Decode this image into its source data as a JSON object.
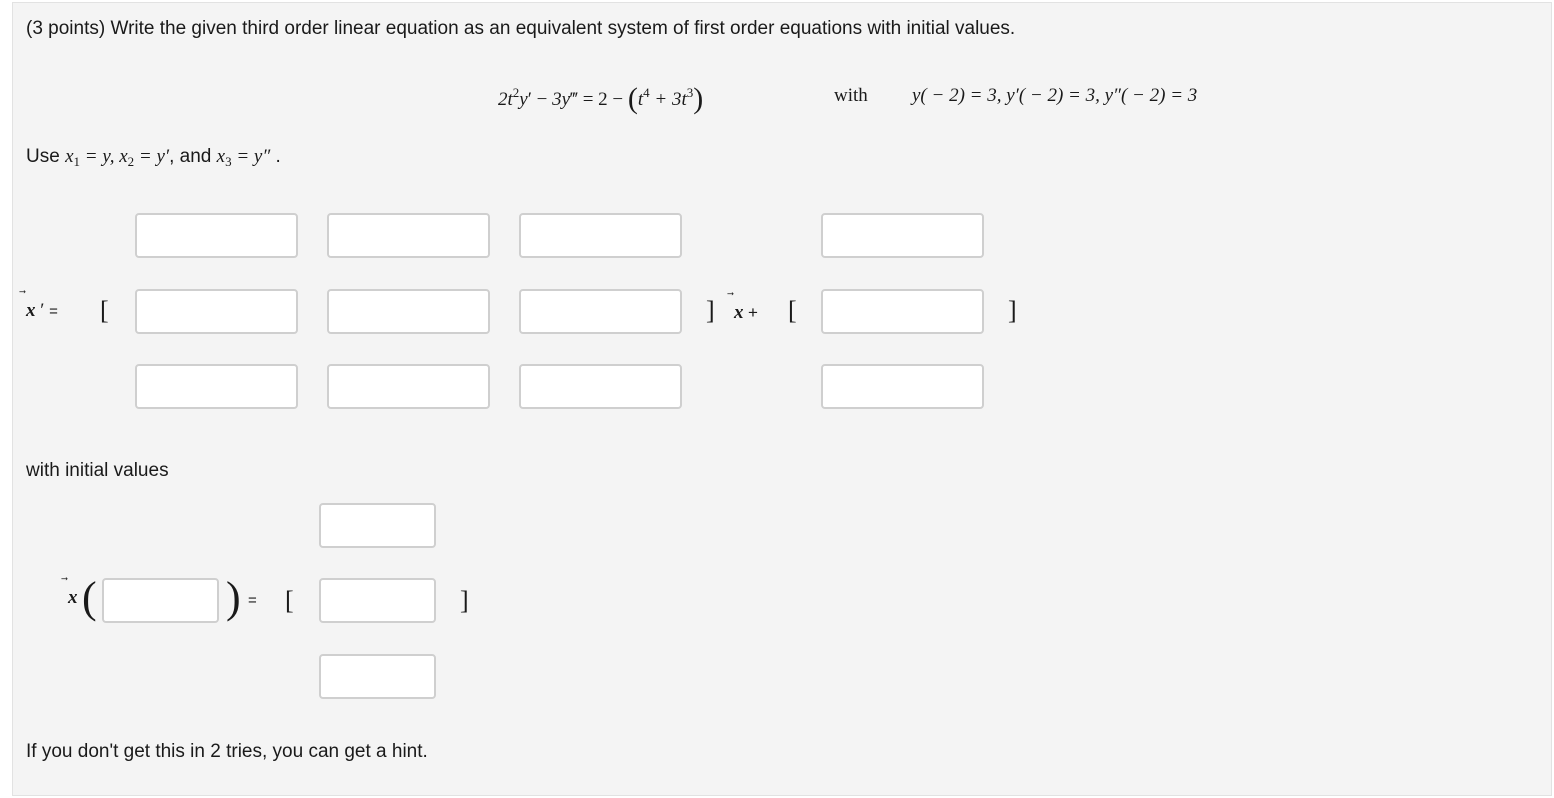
{
  "prompt": "(3 points) Write the given third order linear equation as an equivalent system of first order equations with initial values.",
  "equation": {
    "lhs_a": "2t",
    "lhs_a_exp": "2",
    "lhs_b": "y",
    "lhs_b_prime": "′",
    "minus": "−",
    "lhs_c": "3y",
    "lhs_c_prime": "‴",
    "eq": "=",
    "rhs_const": "2 −",
    "paren_open": "(",
    "rhs_t4": "t",
    "rhs_t4_exp": "4",
    "rhs_plus": "+ 3t",
    "rhs_t3_exp": "3",
    "paren_close": ")"
  },
  "with_label": "with",
  "initial_conditions": "y( − 2) = 3,  y′( − 2) = 3,  y″( − 2) = 3",
  "use_line": {
    "prefix": "Use ",
    "x1": "x",
    "x1_sub": "1",
    "x1_rhs": " = y, ",
    "x2": "x",
    "x2_sub": "2",
    "x2_rhs": " = y′",
    "and": ", and ",
    "x3": "x",
    "x3_sub": "3",
    "x3_rhs": " = y″",
    "period": " ."
  },
  "system": {
    "lhs_vec": "x",
    "lhs_prime": "′",
    "eq": "=",
    "open_bracket": "[",
    "close_bracket": "]",
    "times_vec": "x",
    "plus": "+",
    "open_bracket2": "[",
    "close_bracket2": "]",
    "arrow": "⃗",
    "matrix_values": [
      "",
      "",
      "",
      "",
      "",
      "",
      "",
      "",
      ""
    ],
    "forcing_values": [
      "",
      "",
      ""
    ]
  },
  "initial_values_label": "with initial values",
  "initial": {
    "vec": "x",
    "arrow": "⃗",
    "paren_open": "(",
    "paren_close": ")",
    "eq": "=",
    "open_bracket": "[",
    "close_bracket": "]",
    "t0_value": "",
    "values": [
      "",
      "",
      ""
    ]
  },
  "hint_text": "If you don't get this in 2 tries, you can get a hint."
}
